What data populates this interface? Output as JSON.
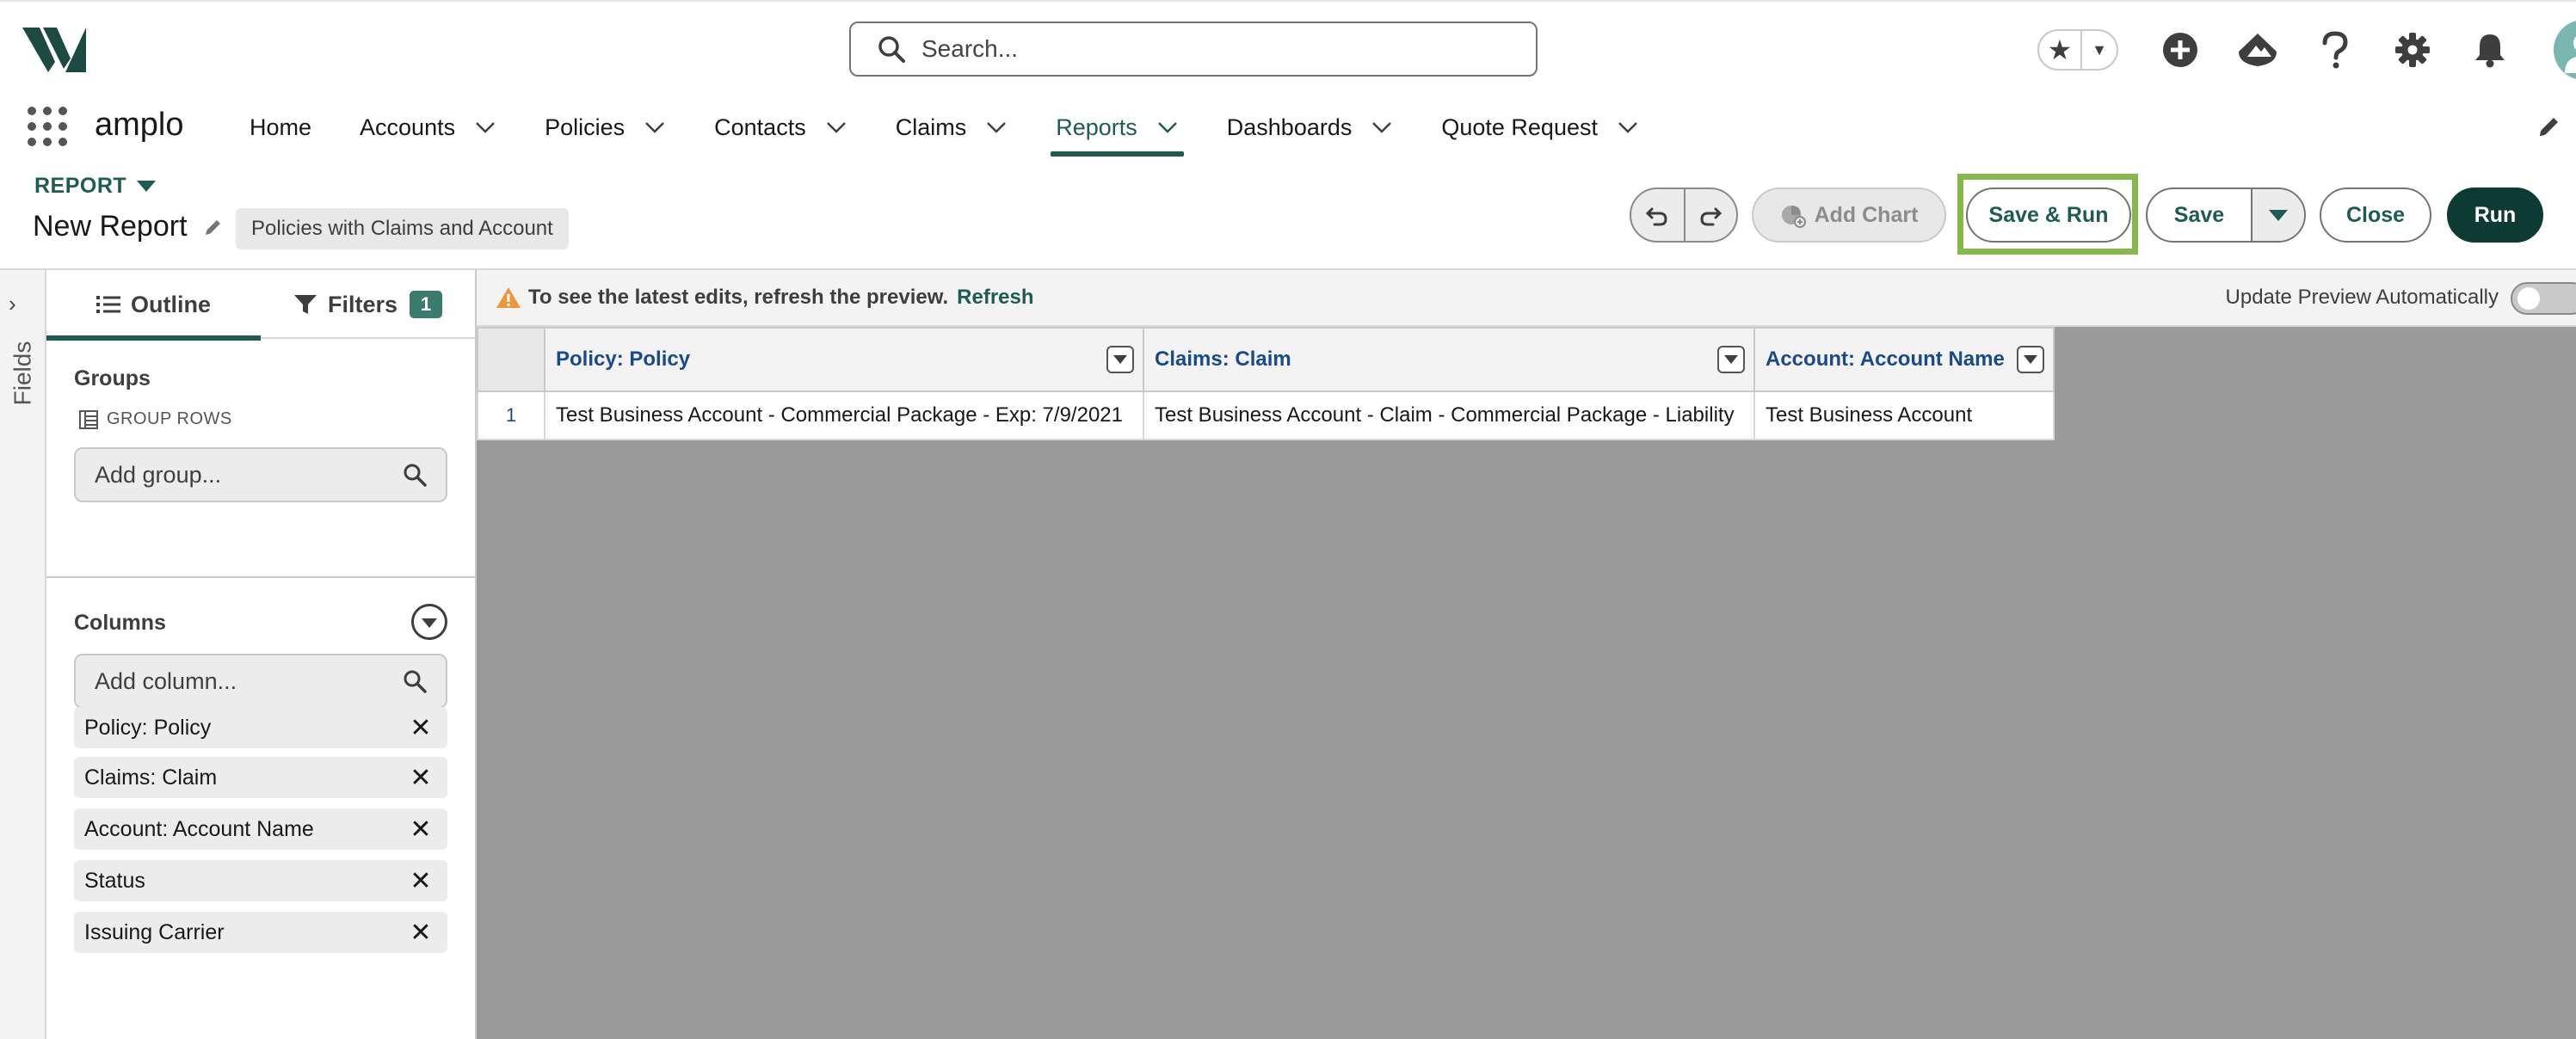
{
  "header": {
    "search_placeholder": "Search...",
    "icons": [
      "favorite-star-icon",
      "add-icon",
      "trailhead-icon",
      "help-icon",
      "setup-gear-icon",
      "notification-bell-icon",
      "user-avatar-icon"
    ]
  },
  "nav": {
    "app_name": "amplo",
    "items": [
      {
        "label": "Home",
        "has_menu": false,
        "active": false
      },
      {
        "label": "Accounts",
        "has_menu": true,
        "active": false
      },
      {
        "label": "Policies",
        "has_menu": true,
        "active": false
      },
      {
        "label": "Contacts",
        "has_menu": true,
        "active": false
      },
      {
        "label": "Claims",
        "has_menu": true,
        "active": false
      },
      {
        "label": "Reports",
        "has_menu": true,
        "active": true
      },
      {
        "label": "Dashboards",
        "has_menu": true,
        "active": false
      },
      {
        "label": "Quote Request",
        "has_menu": true,
        "active": false
      }
    ]
  },
  "report": {
    "label": "REPORT",
    "title": "New Report",
    "type": "Policies with Claims and Account"
  },
  "toolbar": {
    "add_chart": "Add Chart",
    "save_run": "Save & Run",
    "save": "Save",
    "close": "Close",
    "run": "Run"
  },
  "fields_rail": {
    "label": "Fields"
  },
  "panel": {
    "tabs": {
      "outline": "Outline",
      "filters": "Filters",
      "filters_count": "1"
    },
    "groups": {
      "title": "Groups",
      "group_rows_label": "GROUP ROWS",
      "add_group_placeholder": "Add group..."
    },
    "columns": {
      "title": "Columns",
      "add_column_placeholder": "Add column...",
      "items": [
        "Policy: Policy",
        "Claims: Claim",
        "Account: Account Name",
        "Status",
        "Issuing Carrier"
      ]
    }
  },
  "preview": {
    "warning": "To see the latest edits, refresh the preview.",
    "refresh": "Refresh",
    "auto_update_label": "Update Preview Automatically",
    "auto_update_on": false,
    "headers": [
      "Policy: Policy",
      "Claims: Claim",
      "Account: Account Name"
    ],
    "rows": [
      {
        "num": "1",
        "cells": [
          "Test Business Account - Commercial Package - Exp: 7/9/2021",
          "Test Business Account - Claim - Commercial Package - Liability",
          "Test Business Account"
        ]
      }
    ]
  },
  "colors": {
    "brand": "#1e5b53",
    "run_button": "#0e3a34",
    "highlight": "#86b94a",
    "header_link": "#1a4a8a"
  }
}
